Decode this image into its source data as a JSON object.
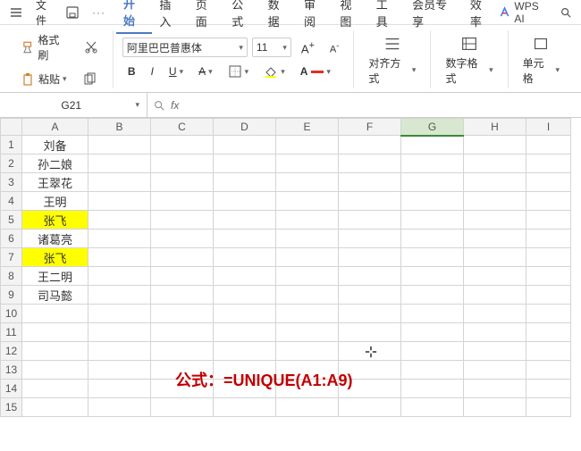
{
  "menu": {
    "file": "文件",
    "tabs": [
      "开始",
      "插入",
      "页面",
      "公式",
      "数据",
      "审阅",
      "视图",
      "工具",
      "会员专享",
      "效率"
    ],
    "active_tab_index": 0,
    "wps_ai": "WPS AI"
  },
  "ribbon": {
    "group1": {
      "format_painter": "格式刷",
      "paste": "粘贴"
    },
    "font": {
      "name": "阿里巴巴普惠体",
      "size": "11",
      "bold": "B",
      "italic": "I",
      "underline": "U",
      "strike": "A"
    },
    "align": {
      "label": "对齐方式"
    },
    "number": {
      "label": "数字格式"
    },
    "cells": {
      "label": "单元格"
    }
  },
  "namebox": {
    "ref": "G21"
  },
  "fx": {
    "label": "fx",
    "value": ""
  },
  "columns": [
    "A",
    "B",
    "C",
    "D",
    "E",
    "F",
    "G",
    "H",
    "I"
  ],
  "selected_col": "G",
  "rows": [
    1,
    2,
    3,
    4,
    5,
    6,
    7,
    8,
    9,
    10,
    11,
    12,
    13,
    14,
    15
  ],
  "cells": {
    "A1": "刘备",
    "A2": "孙二娘",
    "A3": "王翠花",
    "A4": "王明",
    "A5": "张飞",
    "A6": "诸葛亮",
    "A7": "张飞",
    "A8": "王二明",
    "A9": "司马懿"
  },
  "highlight": [
    "A5",
    "A7"
  ],
  "annotation": "公式：=UNIQUE(A1:A9)"
}
